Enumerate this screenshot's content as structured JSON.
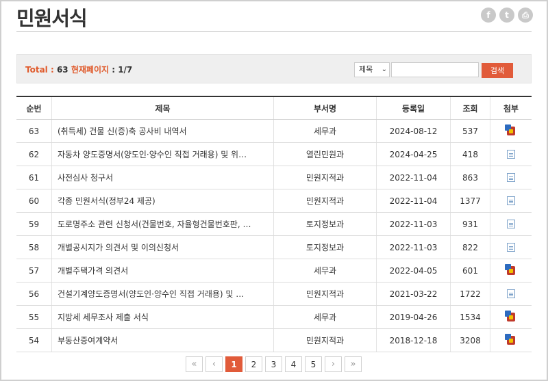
{
  "page": {
    "title": "민원서식"
  },
  "share": {
    "facebook_glyph": "f",
    "twitter_glyph": "t",
    "print_glyph": "⎙"
  },
  "search": {
    "total_label": "Total",
    "total_sep": " : ",
    "total_value": "63",
    "page_label": "현재페이지",
    "page_sep": " : ",
    "page_value": "1/7",
    "select_value": "제목",
    "input_value": "",
    "button_label": "검색"
  },
  "table": {
    "headers": {
      "no": "순번",
      "title": "제목",
      "dept": "부서명",
      "date": "등록일",
      "views": "조회",
      "attach": "첨부"
    },
    "rows": [
      {
        "no": "63",
        "title": "(취득세) 건물 신(증)축 공사비 내역서",
        "dept": "세무과",
        "date": "2024-08-12",
        "views": "537",
        "attach": "hwp-icon"
      },
      {
        "no": "62",
        "title": "자동차 양도증명서(양도인·양수인 직접 거래용) 및 위…",
        "dept": "열린민원과",
        "date": "2024-04-25",
        "views": "418",
        "attach": "doc-icon"
      },
      {
        "no": "61",
        "title": "사전심사 청구서",
        "dept": "민원지적과",
        "date": "2022-11-04",
        "views": "863",
        "attach": "doc-icon"
      },
      {
        "no": "60",
        "title": "각종 민원서식(정부24 제공)",
        "dept": "민원지적과",
        "date": "2022-11-04",
        "views": "1377",
        "attach": "doc-icon"
      },
      {
        "no": "59",
        "title": "도로명주소 관련 신청서(건물번호, 자율형건물번호판, …",
        "dept": "토지정보과",
        "date": "2022-11-03",
        "views": "931",
        "attach": "doc-icon"
      },
      {
        "no": "58",
        "title": "개별공시지가 의견서 및 이의신청서",
        "dept": "토지정보과",
        "date": "2022-11-03",
        "views": "822",
        "attach": "doc-icon"
      },
      {
        "no": "57",
        "title": "개별주택가격 의견서",
        "dept": "세무과",
        "date": "2022-04-05",
        "views": "601",
        "attach": "hwp-icon"
      },
      {
        "no": "56",
        "title": "건설기계양도증명서(양도인·양수인 직접 거래용) 및 …",
        "dept": "민원지적과",
        "date": "2021-03-22",
        "views": "1722",
        "attach": "doc-icon"
      },
      {
        "no": "55",
        "title": "지방세 세무조사 제출 서식",
        "dept": "세무과",
        "date": "2019-04-26",
        "views": "1534",
        "attach": "hwp-icon"
      },
      {
        "no": "54",
        "title": "부동산증여계약서",
        "dept": "민원지적과",
        "date": "2018-12-18",
        "views": "3208",
        "attach": "hwp-icon"
      }
    ]
  },
  "pagination": {
    "first": "«",
    "prev": "‹",
    "pages": [
      "1",
      "2",
      "3",
      "4",
      "5"
    ],
    "active_page": "1",
    "next": "›",
    "last": "»"
  },
  "colors": {
    "accent": "#e15b3a",
    "total_label": "#e05a2b"
  }
}
